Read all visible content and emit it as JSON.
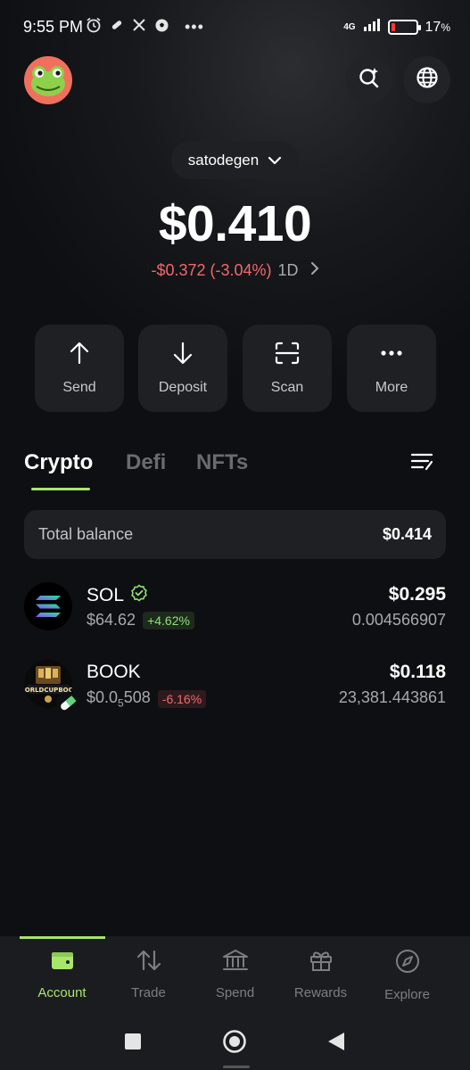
{
  "status_bar": {
    "time": "9:55 PM",
    "network": "4G",
    "battery_percent": "17",
    "battery_symbol": "%",
    "battery_level": 0.17,
    "icons": [
      "alarm-icon",
      "pill-icon",
      "x-icon",
      "soccer-icon",
      "more-dots-icon"
    ]
  },
  "header": {
    "avatar": "frog-avatar",
    "account_name": "satodegen"
  },
  "portfolio": {
    "balance": "$0.410",
    "change": "-$0.372 (-3.04%)",
    "period": "1D"
  },
  "actions": [
    {
      "label": "Send",
      "icon": "arrow-up-icon"
    },
    {
      "label": "Deposit",
      "icon": "arrow-down-icon"
    },
    {
      "label": "Scan",
      "icon": "scan-icon"
    },
    {
      "label": "More",
      "icon": "more-icon"
    }
  ],
  "tabs": [
    {
      "label": "Crypto",
      "active": true
    },
    {
      "label": "Defi",
      "active": false
    },
    {
      "label": "NFTs",
      "active": false
    }
  ],
  "total_balance": {
    "label": "Total balance",
    "value": "$0.414"
  },
  "tokens": [
    {
      "symbol": "SOL",
      "price": "$64.62",
      "change": "+4.62%",
      "value": "$0.295",
      "amount": "0.004566907",
      "verified": true
    },
    {
      "symbol": "BOOK",
      "price_prefix": "$0.0",
      "price_subscript": "5",
      "price_suffix": "508",
      "change": "-6.16%",
      "value": "$0.118",
      "amount": "23,381.443861",
      "logo_text": "WORLDCUPBOOK"
    }
  ],
  "bottom_nav": [
    {
      "label": "Account",
      "icon": "wallet-icon",
      "active": true
    },
    {
      "label": "Trade",
      "icon": "swap-arrows-icon",
      "active": false
    },
    {
      "label": "Spend",
      "icon": "bank-icon",
      "active": false
    },
    {
      "label": "Rewards",
      "icon": "gift-icon",
      "active": false
    },
    {
      "label": "Explore",
      "icon": "compass-icon",
      "active": false
    }
  ],
  "colors": {
    "accent": "#a8e56b",
    "negative": "#ef6a6d",
    "positive": "#8fe07a",
    "background": "#0e0f12",
    "card": "#1f2023"
  }
}
